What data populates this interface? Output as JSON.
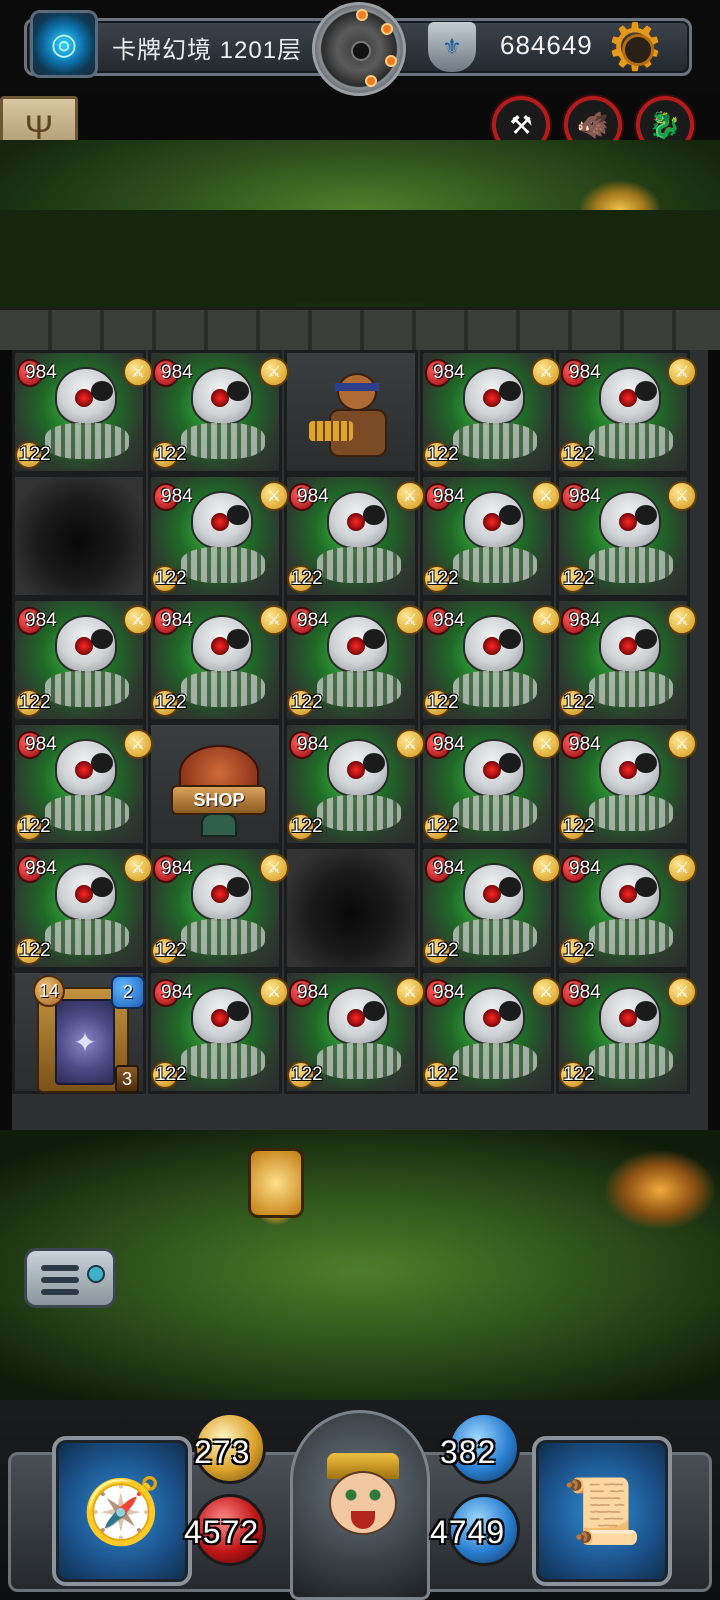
{
  "top_bar": {
    "floor_title": "卡牌幻境 1201层",
    "gold_amount": "684649",
    "portal_icon": "portal-icon",
    "dial_icon": "revolver-dial-icon",
    "shield_icon": "shield-emblem-icon",
    "settings_icon": "gear-icon"
  },
  "side": {
    "candelabra_icon": "candelabra-icon"
  },
  "buffs": [
    {
      "icon": "hammer-buff-icon"
    },
    {
      "icon": "pig-buff-icon"
    },
    {
      "icon": "dragon-buff-icon"
    }
  ],
  "board": {
    "rows": [
      [
        {
          "type": "monster",
          "hp": "984",
          "atk": "122"
        },
        {
          "type": "monster",
          "hp": "984",
          "atk": "122"
        },
        {
          "type": "hero"
        },
        {
          "type": "monster",
          "hp": "984",
          "atk": "122"
        },
        {
          "type": "monster",
          "hp": "984",
          "atk": "122"
        }
      ],
      [
        {
          "type": "hole"
        },
        {
          "type": "monster",
          "hp": "984",
          "atk": "122"
        },
        {
          "type": "monster",
          "hp": "984",
          "atk": "122"
        },
        {
          "type": "monster",
          "hp": "984",
          "atk": "122"
        },
        {
          "type": "monster",
          "hp": "984",
          "atk": "122"
        }
      ],
      [
        {
          "type": "monster",
          "hp": "984",
          "atk": "122"
        },
        {
          "type": "monster",
          "hp": "984",
          "atk": "122"
        },
        {
          "type": "monster",
          "hp": "984",
          "atk": "122"
        },
        {
          "type": "monster",
          "hp": "984",
          "atk": "122"
        },
        {
          "type": "monster",
          "hp": "984",
          "atk": "122"
        }
      ],
      [
        {
          "type": "monster",
          "hp": "984",
          "atk": "122"
        },
        {
          "type": "shop",
          "label": "SHOP"
        },
        {
          "type": "monster",
          "hp": "984",
          "atk": "122"
        },
        {
          "type": "monster",
          "hp": "984",
          "atk": "122"
        },
        {
          "type": "monster",
          "hp": "984",
          "atk": "122"
        }
      ],
      [
        {
          "type": "monster",
          "hp": "984",
          "atk": "122"
        },
        {
          "type": "monster",
          "hp": "984",
          "atk": "122"
        },
        {
          "type": "hole"
        },
        {
          "type": "monster",
          "hp": "984",
          "atk": "122"
        },
        {
          "type": "monster",
          "hp": "984",
          "atk": "122"
        }
      ],
      [
        {
          "type": "deck",
          "left_count": "14",
          "right_count": "2",
          "bottom_count": "3"
        },
        {
          "type": "monster",
          "hp": "984",
          "atk": "122"
        },
        {
          "type": "monster",
          "hp": "984",
          "atk": "122"
        },
        {
          "type": "monster",
          "hp": "984",
          "atk": "122"
        },
        {
          "type": "monster",
          "hp": "984",
          "atk": "122"
        }
      ]
    ]
  },
  "bottom": {
    "lantern_icon": "lantern-icon",
    "menu_icon": "menu-panel-icon"
  },
  "hud": {
    "attack": "273",
    "hp": "4572",
    "defense": "382",
    "gold": "4749",
    "left_slot_icon": "compass-equipment-icon",
    "right_slot_icon": "spellbook-icon",
    "portrait_icon": "hero-portrait"
  },
  "colors": {
    "hp_badge": "#c01616",
    "atk_badge": "#d39615",
    "slot_blue": "#2f8fd8",
    "gold_gear": "#e59a1c"
  }
}
